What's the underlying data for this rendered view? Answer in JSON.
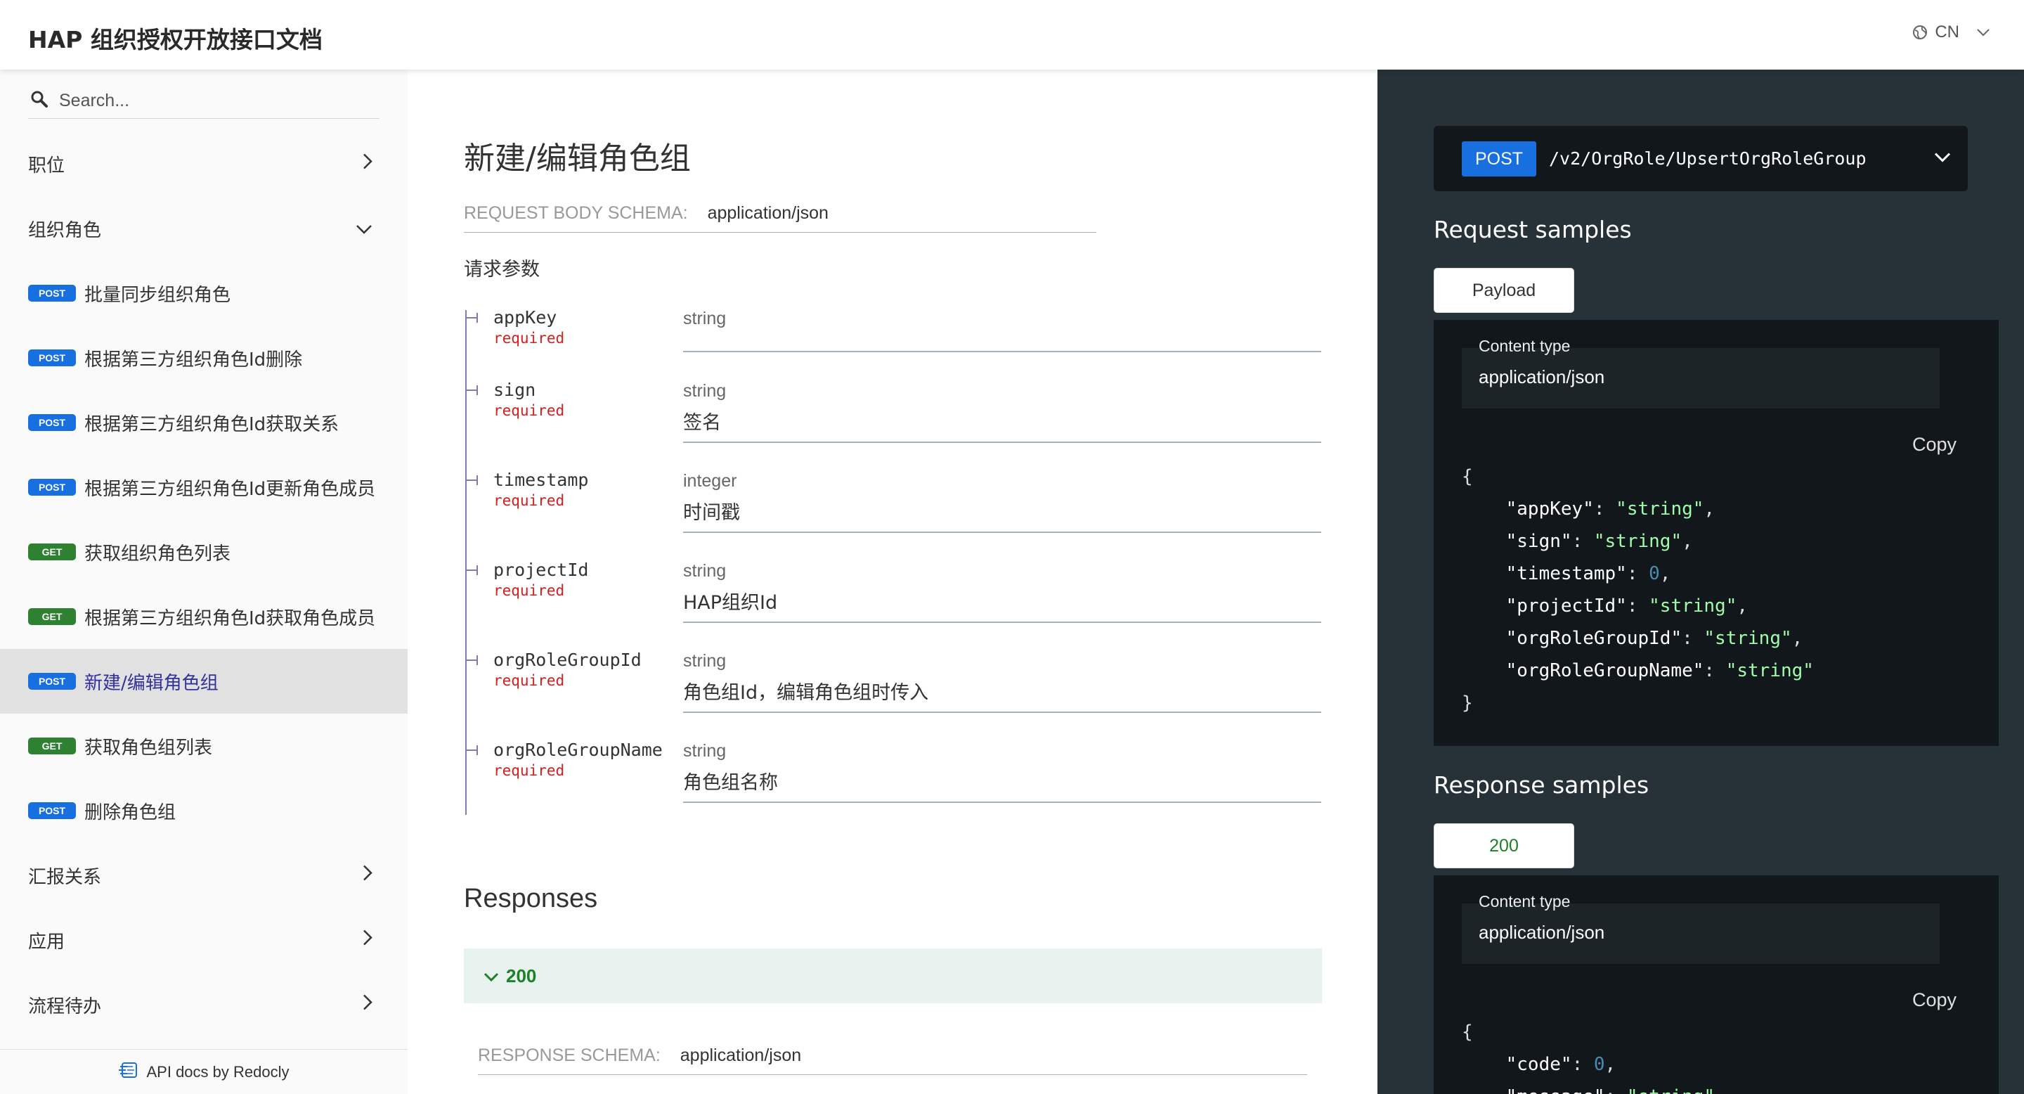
{
  "header": {
    "title": "HAP 组织授权开放接口文档",
    "language": "CN"
  },
  "sidebar": {
    "search_placeholder": "Search...",
    "items": [
      {
        "label": "职位",
        "type": "group",
        "expanded": false
      },
      {
        "label": "组织角色",
        "type": "group",
        "expanded": true
      },
      {
        "label": "批量同步组织角色",
        "method": "POST"
      },
      {
        "label": "根据第三方组织角色Id删除",
        "method": "POST"
      },
      {
        "label": "根据第三方组织角色Id获取关系",
        "method": "POST"
      },
      {
        "label": "根据第三方组织角色Id更新角色成员",
        "method": "POST"
      },
      {
        "label": "获取组织角色列表",
        "method": "GET"
      },
      {
        "label": "根据第三方组织角色Id获取角色成员",
        "method": "GET"
      },
      {
        "label": "新建/编辑角色组",
        "method": "POST",
        "active": true
      },
      {
        "label": "获取角色组列表",
        "method": "GET"
      },
      {
        "label": "删除角色组",
        "method": "POST"
      },
      {
        "label": "汇报关系",
        "type": "group",
        "expanded": false
      },
      {
        "label": "应用",
        "type": "group",
        "expanded": false
      },
      {
        "label": "流程待办",
        "type": "group",
        "expanded": false
      }
    ],
    "footer": "API docs by Redocly"
  },
  "main": {
    "title": "新建/编辑角色组",
    "request_schema_label": "REQUEST BODY SCHEMA:",
    "request_schema_type": "application/json",
    "params_title": "请求参数",
    "params": [
      {
        "name": "appKey",
        "required": "required",
        "type": "string",
        "description": ""
      },
      {
        "name": "sign",
        "required": "required",
        "type": "string",
        "description": "签名"
      },
      {
        "name": "timestamp",
        "required": "required",
        "type": "integer",
        "description": "时间戳"
      },
      {
        "name": "projectId",
        "required": "required",
        "type": "string",
        "description": "HAP组织Id"
      },
      {
        "name": "orgRoleGroupId",
        "required": "required",
        "type": "string",
        "description": "角色组Id，编辑角色组时传入"
      },
      {
        "name": "orgRoleGroupName",
        "required": "required",
        "type": "string",
        "description": "角色组名称"
      }
    ],
    "responses_title": "Responses",
    "response_code": "200",
    "response_schema_label": "RESPONSE SCHEMA:",
    "response_schema_type": "application/json"
  },
  "right_panel": {
    "method": "POST",
    "path": "/v2/OrgRole/UpsertOrgRoleGroup",
    "request_samples_title": "Request samples",
    "request_tab": "Payload",
    "content_type_label": "Content type",
    "content_type_value": "application/json",
    "copy_label": "Copy",
    "request_sample_lines": [
      {
        "key": "appKey",
        "value": "\"string\"",
        "kind": "string"
      },
      {
        "key": "sign",
        "value": "\"string\"",
        "kind": "string"
      },
      {
        "key": "timestamp",
        "value": "0",
        "kind": "number"
      },
      {
        "key": "projectId",
        "value": "\"string\"",
        "kind": "string"
      },
      {
        "key": "orgRoleGroupId",
        "value": "\"string\"",
        "kind": "string"
      },
      {
        "key": "orgRoleGroupName",
        "value": "\"string\"",
        "kind": "string"
      }
    ],
    "response_samples_title": "Response samples",
    "response_tab": "200",
    "response_sample_lines": [
      {
        "key": "code",
        "value": "0",
        "kind": "number"
      },
      {
        "key": "message",
        "value": "\"string\"",
        "kind": "string"
      }
    ]
  },
  "colors": {
    "post_badge": "#186fe0",
    "get_badge": "#2f8132",
    "active_nav_text": "#32329f",
    "required_text": "#d41f1c",
    "right_panel_bg": "#263238",
    "code_bg": "#11171a",
    "string_value": "#a0fbaa",
    "number_value": "#4a8bb3",
    "response_200": "#1d8127"
  }
}
